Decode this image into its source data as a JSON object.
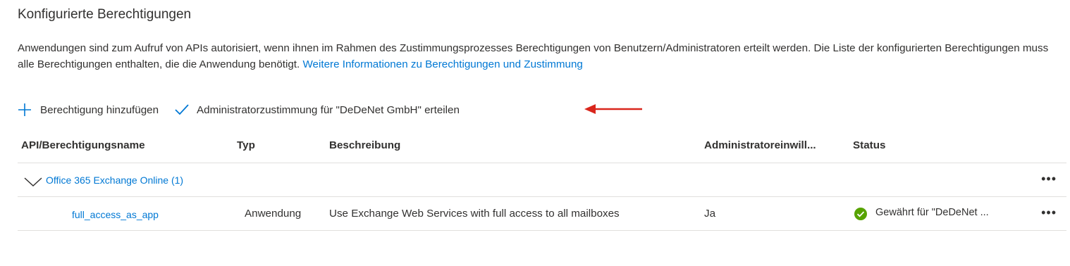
{
  "section": {
    "title": "Konfigurierte Berechtigungen",
    "description": "Anwendungen sind zum Aufruf von APIs autorisiert, wenn ihnen im Rahmen des Zustimmungsprozesses Berechtigungen von Benutzern/Administratoren erteilt werden. Die Liste der konfigurierten Berechtigungen muss alle Berechtigungen enthalten, die die Anwendung benötigt.",
    "link_text": "Weitere Informationen zu Berechtigungen und Zustimmung"
  },
  "toolbar": {
    "add_label": "Berechtigung hinzufügen",
    "grant_label": "Administratorzustimmung für \"DeDeNet GmbH\" erteilen",
    "add_icon": "plus-icon",
    "grant_icon": "checkmark-icon"
  },
  "table": {
    "columns": [
      "API/Berechtigungsname",
      "Typ",
      "Beschreibung",
      "Administratoreinwill...",
      "Status"
    ],
    "group": {
      "label": "Office 365 Exchange Online (1)",
      "more": "•••"
    },
    "rows": [
      {
        "name": "full_access_as_app",
        "type": "Anwendung",
        "description": "Use Exchange Web Services with full access to all mailboxes",
        "admin_consent": "Ja",
        "status": "Gewährt für \"DeDeNet ...",
        "status_color": "#57a300",
        "more": "•••"
      }
    ]
  },
  "colors": {
    "accent": "#0078d4",
    "annotation_arrow": "#d9261c"
  }
}
